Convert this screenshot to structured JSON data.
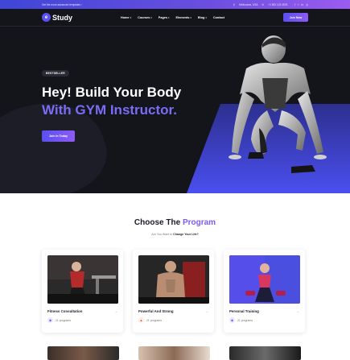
{
  "topbar": {
    "promo": "Get the more advanced templates ›",
    "location": "Melbourne, USA",
    "phone": "+1 800 123 4578",
    "social": [
      "f",
      "t",
      "in",
      "◎"
    ]
  },
  "nav": {
    "logo_mark": "e",
    "logo_text": "Study",
    "menu": [
      {
        "label": "Home",
        "caret": "▾"
      },
      {
        "label": "Courses",
        "caret": "▾"
      },
      {
        "label": "Pages",
        "caret": "▾"
      },
      {
        "label": "Elements",
        "caret": "▾"
      },
      {
        "label": "Blog",
        "caret": "▾"
      },
      {
        "label": "Contact",
        "caret": ""
      }
    ],
    "join_label": "Join Now"
  },
  "hero": {
    "badge": "BESTSELLER",
    "headline_line1": "Hey! Build Your Body",
    "headline_line2": "With GYM Instructor.",
    "cta_label": "Join In Today"
  },
  "section": {
    "title_prefix": "Choose The",
    "title_accent": "Program",
    "subtitle_prefix": "Are You Want to",
    "subtitle_bold": "Change Your Life?"
  },
  "programs": [
    {
      "title": "Fitness Consultation",
      "meta": "21 programs",
      "icon": "weight-icon"
    },
    {
      "title": "Powerful And Strong",
      "meta": "21 programs",
      "icon": "flame-icon"
    },
    {
      "title": "Personal Training",
      "meta": "21 programs",
      "icon": "weight-icon"
    }
  ],
  "colors": {
    "accent": "#7b5cf0",
    "hero_bg": "#14141b",
    "button_gradient_start": "#5a4ff0",
    "button_gradient_end": "#8d5bf5"
  }
}
